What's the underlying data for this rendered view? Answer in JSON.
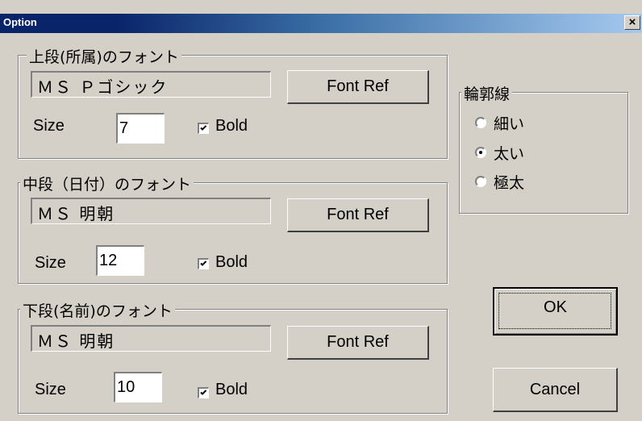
{
  "window": {
    "title": "Option",
    "close_glyph": "×"
  },
  "upper": {
    "legend": "上段(所属)のフォント",
    "font_name": "ＭＳ Ｐゴシック",
    "font_ref_label": "Font Ref",
    "size_label": "Size",
    "size_value": "7",
    "bold_label": "Bold",
    "bold_checked": true
  },
  "middle": {
    "legend": "中段（日付）のフォント",
    "font_name": "ＭＳ 明朝",
    "font_ref_label": "Font Ref",
    "size_label": "Size",
    "size_value": "12",
    "bold_label": "Bold",
    "bold_checked": true
  },
  "lower": {
    "legend": "下段(名前)のフォント",
    "font_name": "ＭＳ 明朝",
    "font_ref_label": "Font Ref",
    "size_label": "Size",
    "size_value": "10",
    "bold_label": "Bold",
    "bold_checked": true
  },
  "outline": {
    "legend": "輪郭線",
    "options": [
      {
        "label": "細い",
        "selected": false
      },
      {
        "label": "太い",
        "selected": true
      },
      {
        "label": "極太",
        "selected": false
      }
    ]
  },
  "buttons": {
    "ok": "OK",
    "cancel": "Cancel"
  },
  "colors": {
    "face": "#d4d0c8",
    "title_active": "#0a246a",
    "shadow": "#808080",
    "highlight": "#ffffff"
  }
}
